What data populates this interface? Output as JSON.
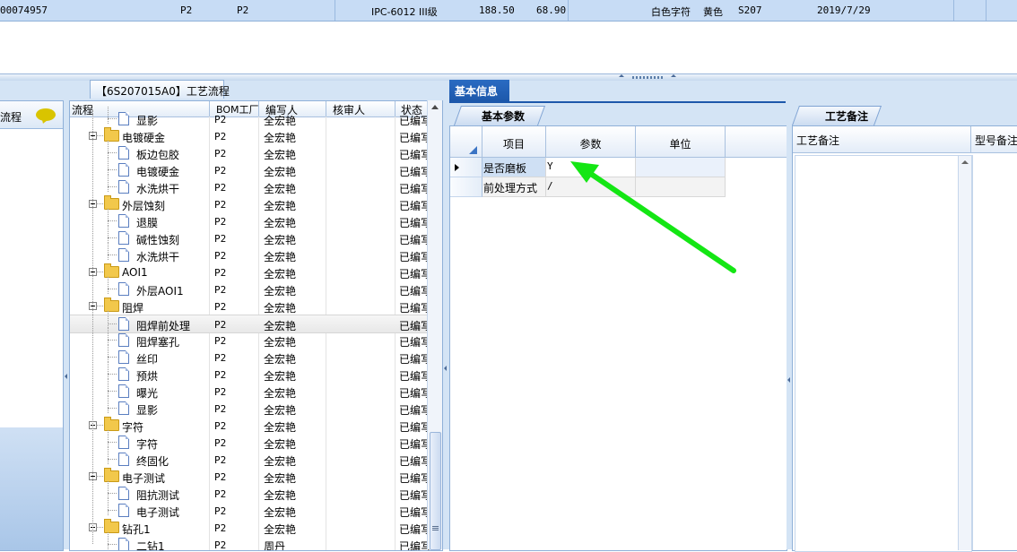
{
  "top_row": {
    "code": "00074957",
    "factory1": "P2",
    "factory2": "P2",
    "standard": "IPC-6012 III级",
    "value1": "188.50",
    "value2": "68.90",
    "char_color": "白色字符",
    "color": "黄色",
    "model": "S207",
    "date": "2019/7/29"
  },
  "left_panel": {
    "header": "流程",
    "icon": "speech-bubble-icon"
  },
  "tree_panel": {
    "tab_title": "【6S207015A0】工艺流程",
    "columns": [
      "流程",
      "BOM工厂",
      "编写人",
      "核审人",
      "状态"
    ],
    "rows": [
      {
        "name": "显影",
        "type": "doc",
        "level": 2,
        "factory": "P2",
        "writer": "全宏艳",
        "status": "已编写"
      },
      {
        "name": "电镀硬金",
        "type": "folder",
        "level": 1,
        "factory": "P2",
        "writer": "全宏艳",
        "status": "已编写"
      },
      {
        "name": "板边包胶",
        "type": "doc",
        "level": 2,
        "factory": "P2",
        "writer": "全宏艳",
        "status": "已编写"
      },
      {
        "name": "电镀硬金",
        "type": "doc",
        "level": 2,
        "factory": "P2",
        "writer": "全宏艳",
        "status": "已编写"
      },
      {
        "name": "水洗烘干",
        "type": "doc",
        "level": 2,
        "factory": "P2",
        "writer": "全宏艳",
        "status": "已编写"
      },
      {
        "name": "外层蚀刻",
        "type": "folder",
        "level": 1,
        "factory": "P2",
        "writer": "全宏艳",
        "status": "已编写"
      },
      {
        "name": "退膜",
        "type": "doc",
        "level": 2,
        "factory": "P2",
        "writer": "全宏艳",
        "status": "已编写"
      },
      {
        "name": "碱性蚀刻",
        "type": "doc",
        "level": 2,
        "factory": "P2",
        "writer": "全宏艳",
        "status": "已编写"
      },
      {
        "name": "水洗烘干",
        "type": "doc",
        "level": 2,
        "factory": "P2",
        "writer": "全宏艳",
        "status": "已编写"
      },
      {
        "name": "AOI1",
        "type": "folder",
        "level": 1,
        "factory": "P2",
        "writer": "全宏艳",
        "status": "已编写"
      },
      {
        "name": "外层AOI1",
        "type": "doc",
        "level": 2,
        "factory": "P2",
        "writer": "全宏艳",
        "status": "已编写"
      },
      {
        "name": "阻焊",
        "type": "folder",
        "level": 1,
        "factory": "P2",
        "writer": "全宏艳",
        "status": "已编写"
      },
      {
        "name": "阻焊前处理",
        "type": "doc",
        "level": 2,
        "factory": "P2",
        "writer": "全宏艳",
        "status": "已编写",
        "selected": true
      },
      {
        "name": "阻焊塞孔",
        "type": "doc",
        "level": 2,
        "factory": "P2",
        "writer": "全宏艳",
        "status": "已编写"
      },
      {
        "name": "丝印",
        "type": "doc",
        "level": 2,
        "factory": "P2",
        "writer": "全宏艳",
        "status": "已编写"
      },
      {
        "name": "预烘",
        "type": "doc",
        "level": 2,
        "factory": "P2",
        "writer": "全宏艳",
        "status": "已编写"
      },
      {
        "name": "曝光",
        "type": "doc",
        "level": 2,
        "factory": "P2",
        "writer": "全宏艳",
        "status": "已编写"
      },
      {
        "name": "显影",
        "type": "doc",
        "level": 2,
        "factory": "P2",
        "writer": "全宏艳",
        "status": "已编写"
      },
      {
        "name": "字符",
        "type": "folder",
        "level": 1,
        "factory": "P2",
        "writer": "全宏艳",
        "status": "已编写"
      },
      {
        "name": "字符",
        "type": "doc",
        "level": 2,
        "factory": "P2",
        "writer": "全宏艳",
        "status": "已编写"
      },
      {
        "name": "终固化",
        "type": "doc",
        "level": 2,
        "factory": "P2",
        "writer": "全宏艳",
        "status": "已编写"
      },
      {
        "name": "电子测试",
        "type": "folder",
        "level": 1,
        "factory": "P2",
        "writer": "全宏艳",
        "status": "已编写"
      },
      {
        "name": "阻抗测试",
        "type": "doc",
        "level": 2,
        "factory": "P2",
        "writer": "全宏艳",
        "status": "已编写"
      },
      {
        "name": "电子测试",
        "type": "doc",
        "level": 2,
        "factory": "P2",
        "writer": "全宏艳",
        "status": "已编写"
      },
      {
        "name": "钻孔1",
        "type": "folder",
        "level": 1,
        "factory": "P2",
        "writer": "全宏艳",
        "status": "已编写"
      },
      {
        "name": "二钻1",
        "type": "doc",
        "level": 2,
        "factory": "P2",
        "writer": "周丹",
        "status": "已编写"
      }
    ]
  },
  "basic_info": {
    "tab": "基本信息",
    "subtab": "基本参数",
    "columns": [
      "项目",
      "参数",
      "单位"
    ],
    "rows": [
      {
        "item": "是否磨板",
        "param": "Y",
        "unit": ""
      },
      {
        "item": "前处理方式",
        "param": "/",
        "unit": ""
      }
    ],
    "annotation_color": "#14e614"
  },
  "notes_panel": {
    "tab": "工艺备注",
    "col1": "工艺备注",
    "col2": "型号备注"
  },
  "colors": {
    "accent": "#1d58ab",
    "panel_bg": "#d4e4f5",
    "top_row": "#c7dcf5",
    "folder": "#f2c84b"
  }
}
